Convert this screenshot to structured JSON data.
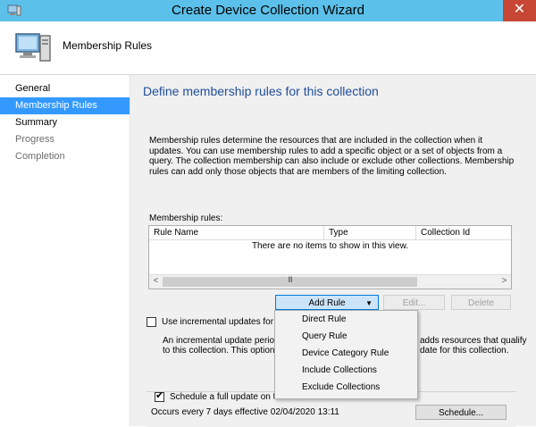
{
  "window": {
    "title": "Create Device Collection Wizard",
    "close_glyph": "✕"
  },
  "header": {
    "title": "Membership Rules"
  },
  "nav": {
    "items": [
      {
        "label": "General",
        "state": "normal"
      },
      {
        "label": "Membership Rules",
        "state": "selected"
      },
      {
        "label": "Summary",
        "state": "normal"
      },
      {
        "label": "Progress",
        "state": "disabled"
      },
      {
        "label": "Completion",
        "state": "disabled"
      }
    ]
  },
  "main": {
    "heading": "Define membership rules for this collection",
    "description": "Membership rules determine the resources that are included in the collection when it updates. You can use membership rules to add a specific object or a set of objects from a query. The collection membership can also include or exclude other collections. Membership rules can add only those objects that are members of the limiting collection.",
    "rules_label": "Membership rules:",
    "grid": {
      "columns": [
        "Rule Name",
        "Type",
        "Collection Id"
      ],
      "empty_text": "There are no items to show in this view.",
      "scroll_left": "<",
      "scroll_right": ">",
      "scroll_grip": "III"
    },
    "buttons": {
      "add_rule": "Add Rule",
      "edit": "Edit...",
      "delete": "Delete",
      "schedule": "Schedule..."
    },
    "incremental": {
      "label": "Use incremental updates for this",
      "checked": false,
      "desc_line1": "An incremental update periodic",
      "desc_line1_right": "adds resources that qualify",
      "desc_line2": "to this collection. This option do",
      "desc_line2_right": "date for this collection."
    },
    "full_update": {
      "label": "Schedule a full update on this collection",
      "checked": true,
      "schedule_text": "Occurs every 7 days effective 02/04/2020 13:11"
    }
  },
  "add_rule_menu": {
    "items": [
      "Direct Rule",
      "Query Rule",
      "Device Category Rule",
      "Include Collections",
      "Exclude Collections"
    ]
  },
  "colors": {
    "titlebar": "#5bc0ea",
    "accent": "#3399ff",
    "heading": "#1f4e99",
    "close": "#c74634"
  }
}
